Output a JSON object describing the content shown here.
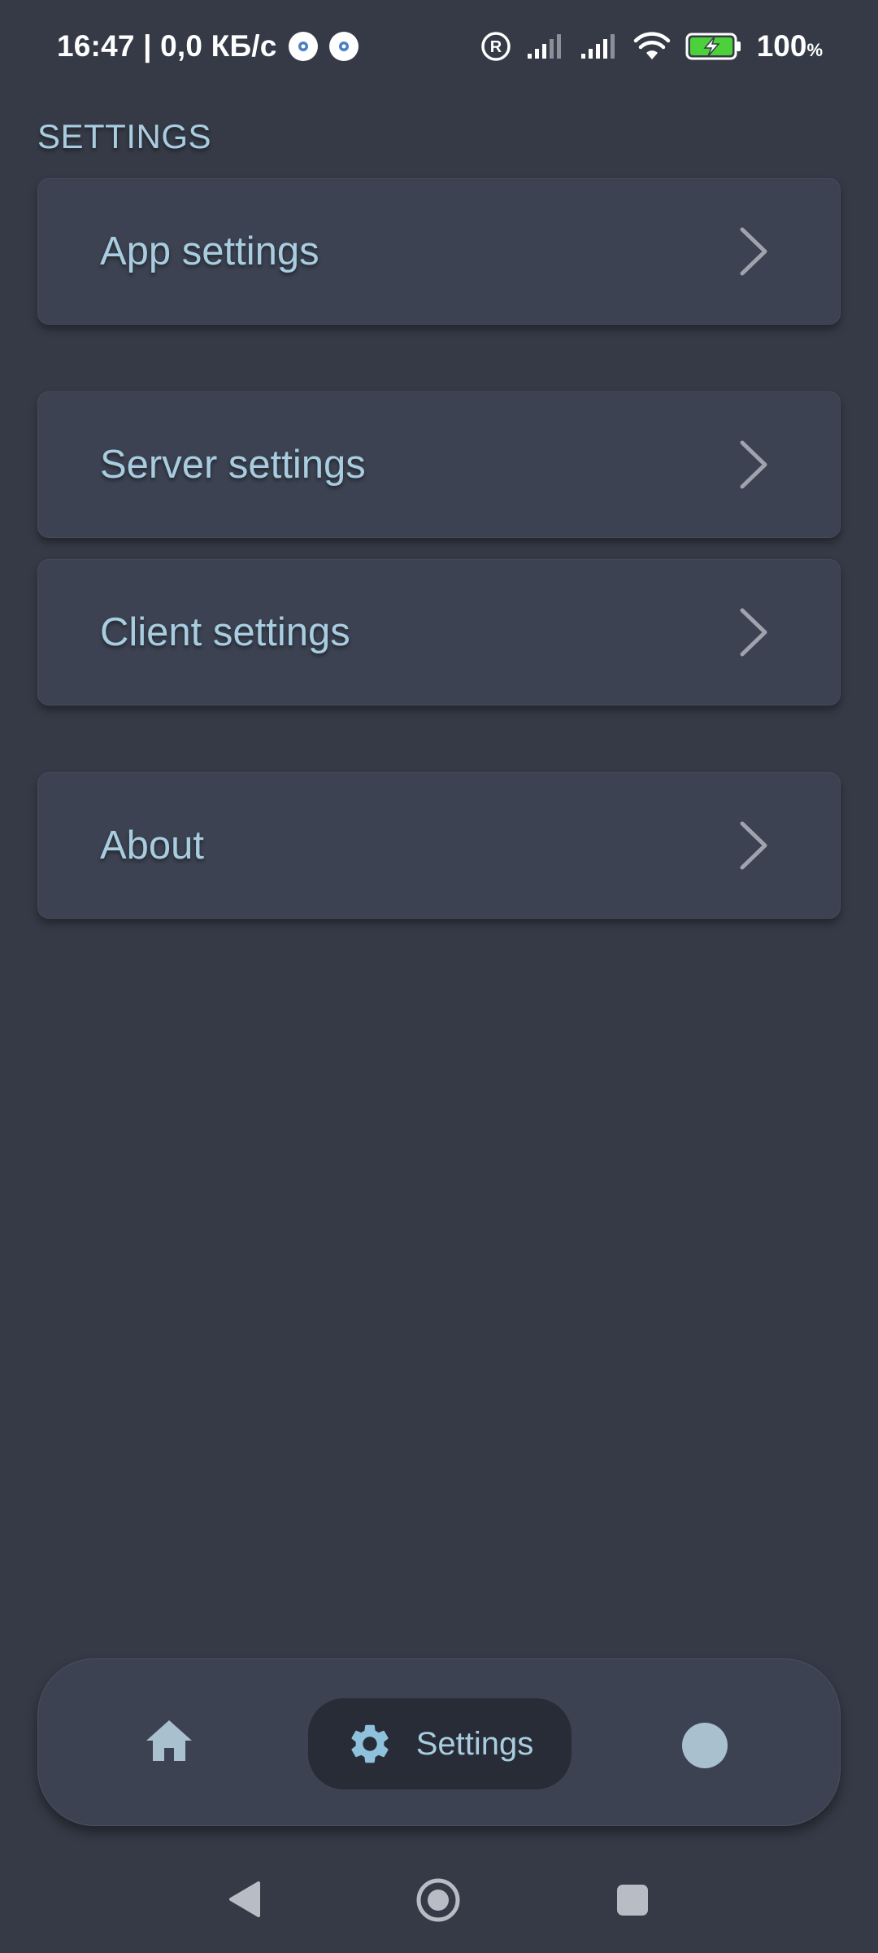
{
  "status_bar": {
    "time_and_speed": "16:47 | 0,0 КБ/с",
    "battery_percent": "100",
    "battery_unit": "%",
    "icons": [
      "gear-notification-icon",
      "gear-notification-icon",
      "registered-icon",
      "signal-icon",
      "signal-icon",
      "wifi-icon",
      "battery-charging-icon"
    ]
  },
  "header": {
    "title": "SETTINGS"
  },
  "menu": {
    "items": [
      {
        "label": "App settings",
        "icon": "chevron-right-icon"
      },
      {
        "label": "Server settings",
        "icon": "chevron-right-icon"
      },
      {
        "label": "Client settings",
        "icon": "chevron-right-icon"
      },
      {
        "label": "About",
        "icon": "chevron-right-icon"
      }
    ]
  },
  "bottom_nav": {
    "items": [
      {
        "icon": "home-icon",
        "label": ""
      },
      {
        "icon": "gear-icon",
        "label": "Settings",
        "active": true
      },
      {
        "icon": "circle-icon",
        "label": ""
      }
    ]
  },
  "system_nav": {
    "icons": [
      "back-icon",
      "home-circle-icon",
      "recent-apps-icon"
    ]
  },
  "colors": {
    "background": "#353a46",
    "card": "#3c4251",
    "accent_text": "#a9cde0",
    "active_pill": "#282c36",
    "battery_green": "#4cd13a"
  }
}
